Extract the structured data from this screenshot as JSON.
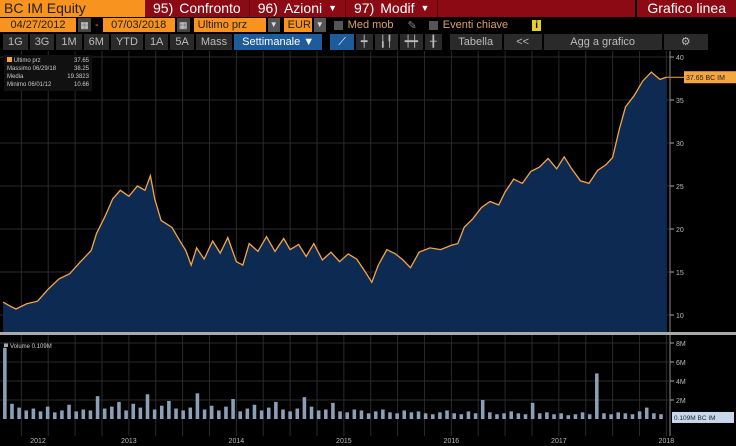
{
  "header": {
    "ticker": "BC IM Equity",
    "menu": [
      {
        "num": "95)",
        "label": "Confronto"
      },
      {
        "num": "96)",
        "label": "Azioni"
      },
      {
        "num": "97)",
        "label": "Modif"
      }
    ],
    "title": "Grafico linea"
  },
  "controls": {
    "start_date": "04/27/2012",
    "end_date": "07/03/2018",
    "field": "Ultimo prz",
    "currency": "EUR",
    "med_mob": "Med mob",
    "eventi": "Eventi chiave",
    "info": "i"
  },
  "periods": [
    "1G",
    "3G",
    "1M",
    "6M",
    "YTD",
    "1A",
    "5A",
    "Mass"
  ],
  "frequency": "Settimanale ▼",
  "toolbar": {
    "table": "Tabella",
    "collapse": "<<",
    "add": "Agg a grafico"
  },
  "legend": [
    {
      "label": "Ultimo prz",
      "value": "37.65"
    },
    {
      "label": "Massimo 06/29/18",
      "value": "38.25"
    },
    {
      "label": "Media",
      "value": "19.3823"
    },
    {
      "label": "Minimo 06/01/12",
      "value": "10.66"
    }
  ],
  "colors": {
    "line": "#f7a540",
    "fill": "#0d2a52",
    "accent": "#f7931e"
  },
  "chart_data": {
    "type": "area",
    "price_label": "37.65 BC IM",
    "volume_label": "0.109M BC IM",
    "volume_legend": "Volume 0.109M",
    "x_ticks": [
      "2012",
      "2013",
      "2014",
      "2015",
      "2016",
      "2017",
      "2018"
    ],
    "y_ticks": [
      10,
      15,
      20,
      25,
      30,
      35,
      40
    ],
    "ylim": [
      8,
      40.5
    ],
    "vol_ticks": [
      "2M",
      "4M",
      "6M",
      "8M"
    ],
    "vol_ylim": [
      0,
      8.5
    ],
    "price": [
      [
        2012.33,
        11.5
      ],
      [
        2012.4,
        11
      ],
      [
        2012.45,
        10.7
      ],
      [
        2012.55,
        11.3
      ],
      [
        2012.65,
        11.6
      ],
      [
        2012.75,
        13
      ],
      [
        2012.85,
        14.2
      ],
      [
        2012.95,
        14.8
      ],
      [
        2013.05,
        16.2
      ],
      [
        2013.15,
        17.5
      ],
      [
        2013.2,
        19.5
      ],
      [
        2013.28,
        21.5
      ],
      [
        2013.35,
        23.5
      ],
      [
        2013.42,
        24.5
      ],
      [
        2013.5,
        23.8
      ],
      [
        2013.58,
        25
      ],
      [
        2013.65,
        24.5
      ],
      [
        2013.7,
        26.2
      ],
      [
        2013.74,
        23.5
      ],
      [
        2013.8,
        21
      ],
      [
        2013.9,
        20.2
      ],
      [
        2013.98,
        18.5
      ],
      [
        2014.03,
        17.5
      ],
      [
        2014.08,
        15.8
      ],
      [
        2014.13,
        17.8
      ],
      [
        2014.2,
        16.5
      ],
      [
        2014.28,
        18.6
      ],
      [
        2014.35,
        17.2
      ],
      [
        2014.42,
        19
      ],
      [
        2014.5,
        16.2
      ],
      [
        2014.56,
        15.8
      ],
      [
        2014.62,
        18.3
      ],
      [
        2014.7,
        17.4
      ],
      [
        2014.78,
        19.1
      ],
      [
        2014.86,
        17.4
      ],
      [
        2014.94,
        18.9
      ],
      [
        2015.0,
        17.6
      ],
      [
        2015.08,
        18.2
      ],
      [
        2015.15,
        16.8
      ],
      [
        2015.22,
        18.3
      ],
      [
        2015.3,
        16.4
      ],
      [
        2015.38,
        17.3
      ],
      [
        2015.46,
        16.2
      ],
      [
        2015.54,
        17.1
      ],
      [
        2015.62,
        16.5
      ],
      [
        2015.7,
        15
      ],
      [
        2015.76,
        13.8
      ],
      [
        2015.82,
        15.8
      ],
      [
        2015.9,
        17.6
      ],
      [
        2015.98,
        17.1
      ],
      [
        2016.05,
        16.4
      ],
      [
        2016.12,
        15.5
      ],
      [
        2016.2,
        17.3
      ],
      [
        2016.3,
        17.8
      ],
      [
        2016.4,
        17.6
      ],
      [
        2016.5,
        18.1
      ],
      [
        2016.56,
        18.3
      ],
      [
        2016.62,
        20.2
      ],
      [
        2016.7,
        21.2
      ],
      [
        2016.78,
        22.5
      ],
      [
        2016.86,
        23.2
      ],
      [
        2016.94,
        22.8
      ],
      [
        2017.0,
        24.3
      ],
      [
        2017.08,
        25.8
      ],
      [
        2017.16,
        25.3
      ],
      [
        2017.24,
        26.7
      ],
      [
        2017.32,
        27.2
      ],
      [
        2017.4,
        28.2
      ],
      [
        2017.48,
        27
      ],
      [
        2017.55,
        28.4
      ],
      [
        2017.62,
        27
      ],
      [
        2017.7,
        25.6
      ],
      [
        2017.78,
        25.3
      ],
      [
        2017.86,
        26.8
      ],
      [
        2017.94,
        27.5
      ],
      [
        2018.0,
        28.3
      ],
      [
        2018.06,
        31.5
      ],
      [
        2018.12,
        34.2
      ],
      [
        2018.2,
        35.5
      ],
      [
        2018.28,
        37.2
      ],
      [
        2018.36,
        38.25
      ],
      [
        2018.44,
        37.4
      ],
      [
        2018.5,
        37.65
      ]
    ],
    "volume": [
      7.5,
      1.6,
      1.2,
      0.9,
      1.1,
      0.8,
      1.3,
      0.7,
      0.9,
      1.5,
      0.8,
      1.0,
      0.9,
      2.4,
      1.1,
      1.3,
      1.8,
      0.9,
      1.6,
      1.2,
      2.6,
      1.0,
      1.4,
      1.9,
      1.1,
      0.9,
      1.2,
      2.7,
      1.0,
      1.4,
      0.9,
      1.3,
      2.1,
      0.8,
      1.1,
      1.5,
      0.9,
      1.2,
      1.8,
      1.0,
      0.8,
      1.1,
      2.3,
      1.3,
      0.9,
      1.0,
      1.7,
      0.8,
      0.7,
      1.0,
      0.9,
      0.6,
      0.8,
      1.0,
      0.7,
      0.6,
      0.9,
      0.7,
      0.8,
      0.6,
      0.5,
      0.7,
      0.9,
      0.6,
      0.5,
      0.8,
      0.6,
      2.0,
      0.7,
      0.5,
      0.6,
      0.8,
      0.6,
      0.5,
      1.7,
      0.6,
      0.7,
      0.5,
      0.6,
      0.4,
      0.5,
      0.7,
      0.5,
      4.8,
      0.6,
      0.5,
      0.7,
      0.6,
      0.5,
      0.8,
      1.2,
      0.6,
      0.5
    ]
  }
}
